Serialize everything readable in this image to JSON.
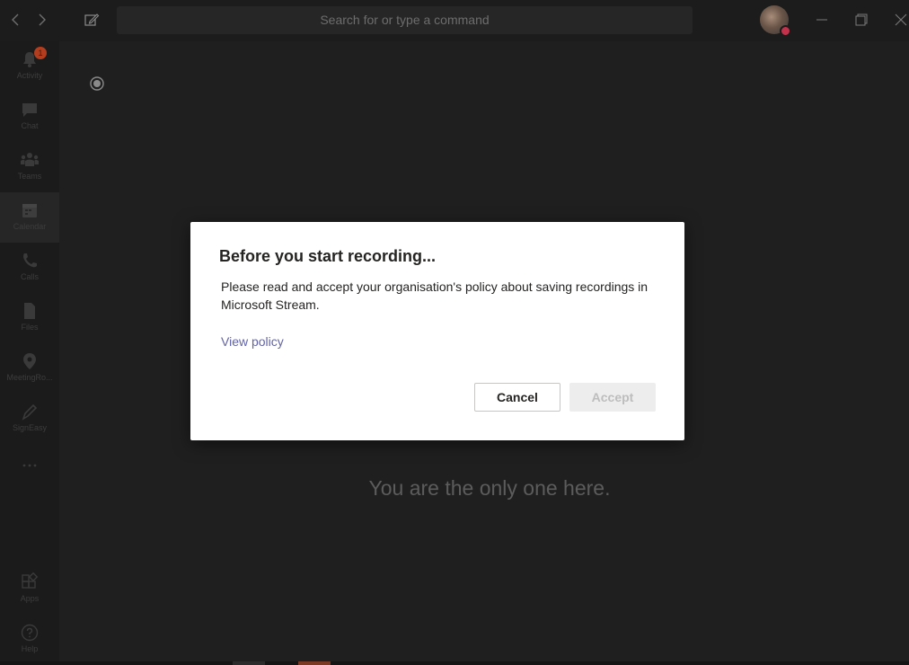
{
  "topbar": {
    "back_icon": "chevron-left-icon",
    "forward_icon": "chevron-right-icon",
    "compose_icon": "compose-icon",
    "search_placeholder": "Search for or type a command",
    "window_controls": [
      "minimize-icon",
      "restore-icon",
      "close-icon"
    ]
  },
  "rail": {
    "items": [
      {
        "label": "Activity",
        "icon": "bell-icon",
        "badge": "1"
      },
      {
        "label": "Chat",
        "icon": "chat-icon"
      },
      {
        "label": "Teams",
        "icon": "teams-icon"
      },
      {
        "label": "Calendar",
        "icon": "calendar-icon",
        "active": true
      },
      {
        "label": "Calls",
        "icon": "phone-icon"
      },
      {
        "label": "Files",
        "icon": "file-icon"
      },
      {
        "label": "MeetingRo...",
        "icon": "location-pin-icon"
      },
      {
        "label": "SignEasy",
        "icon": "pen-icon"
      },
      {
        "label": "",
        "icon": "more-icon"
      },
      {
        "label": "Apps",
        "icon": "apps-icon"
      },
      {
        "label": "Help",
        "icon": "help-icon"
      }
    ]
  },
  "stage": {
    "status_text": "You are the only one here."
  },
  "dialog": {
    "title": "Before you start recording...",
    "body": "Please read and accept your organisation's policy about saving recordings in Microsoft Stream.",
    "link_label": "View policy",
    "cancel_label": "Cancel",
    "accept_label": "Accept"
  },
  "colors": {
    "background": "#1f1f1f",
    "dialog": "#ffffff",
    "link": "#6264a7",
    "badge": "#b33e1f"
  }
}
